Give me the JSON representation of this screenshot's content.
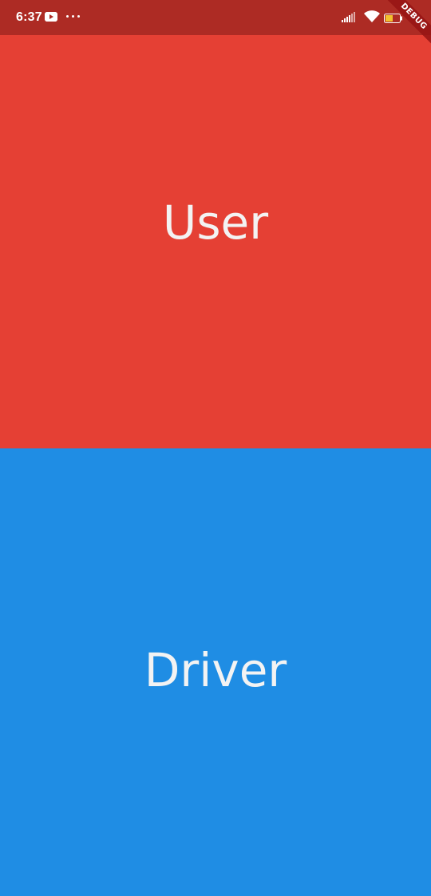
{
  "status_bar": {
    "time": "6:37",
    "battery_label": "battery"
  },
  "debug_banner": {
    "label": "DEBUG"
  },
  "panels": {
    "user": {
      "label": "User",
      "color": "#e54034"
    },
    "driver": {
      "label": "Driver",
      "color": "#1f8de4"
    }
  },
  "colors": {
    "status_bar": "#ad2b24",
    "label_text": "#f3f3f3"
  },
  "icons": [
    "youtube-icon",
    "more-icon",
    "signal-icon",
    "wifi-icon",
    "battery-icon"
  ]
}
